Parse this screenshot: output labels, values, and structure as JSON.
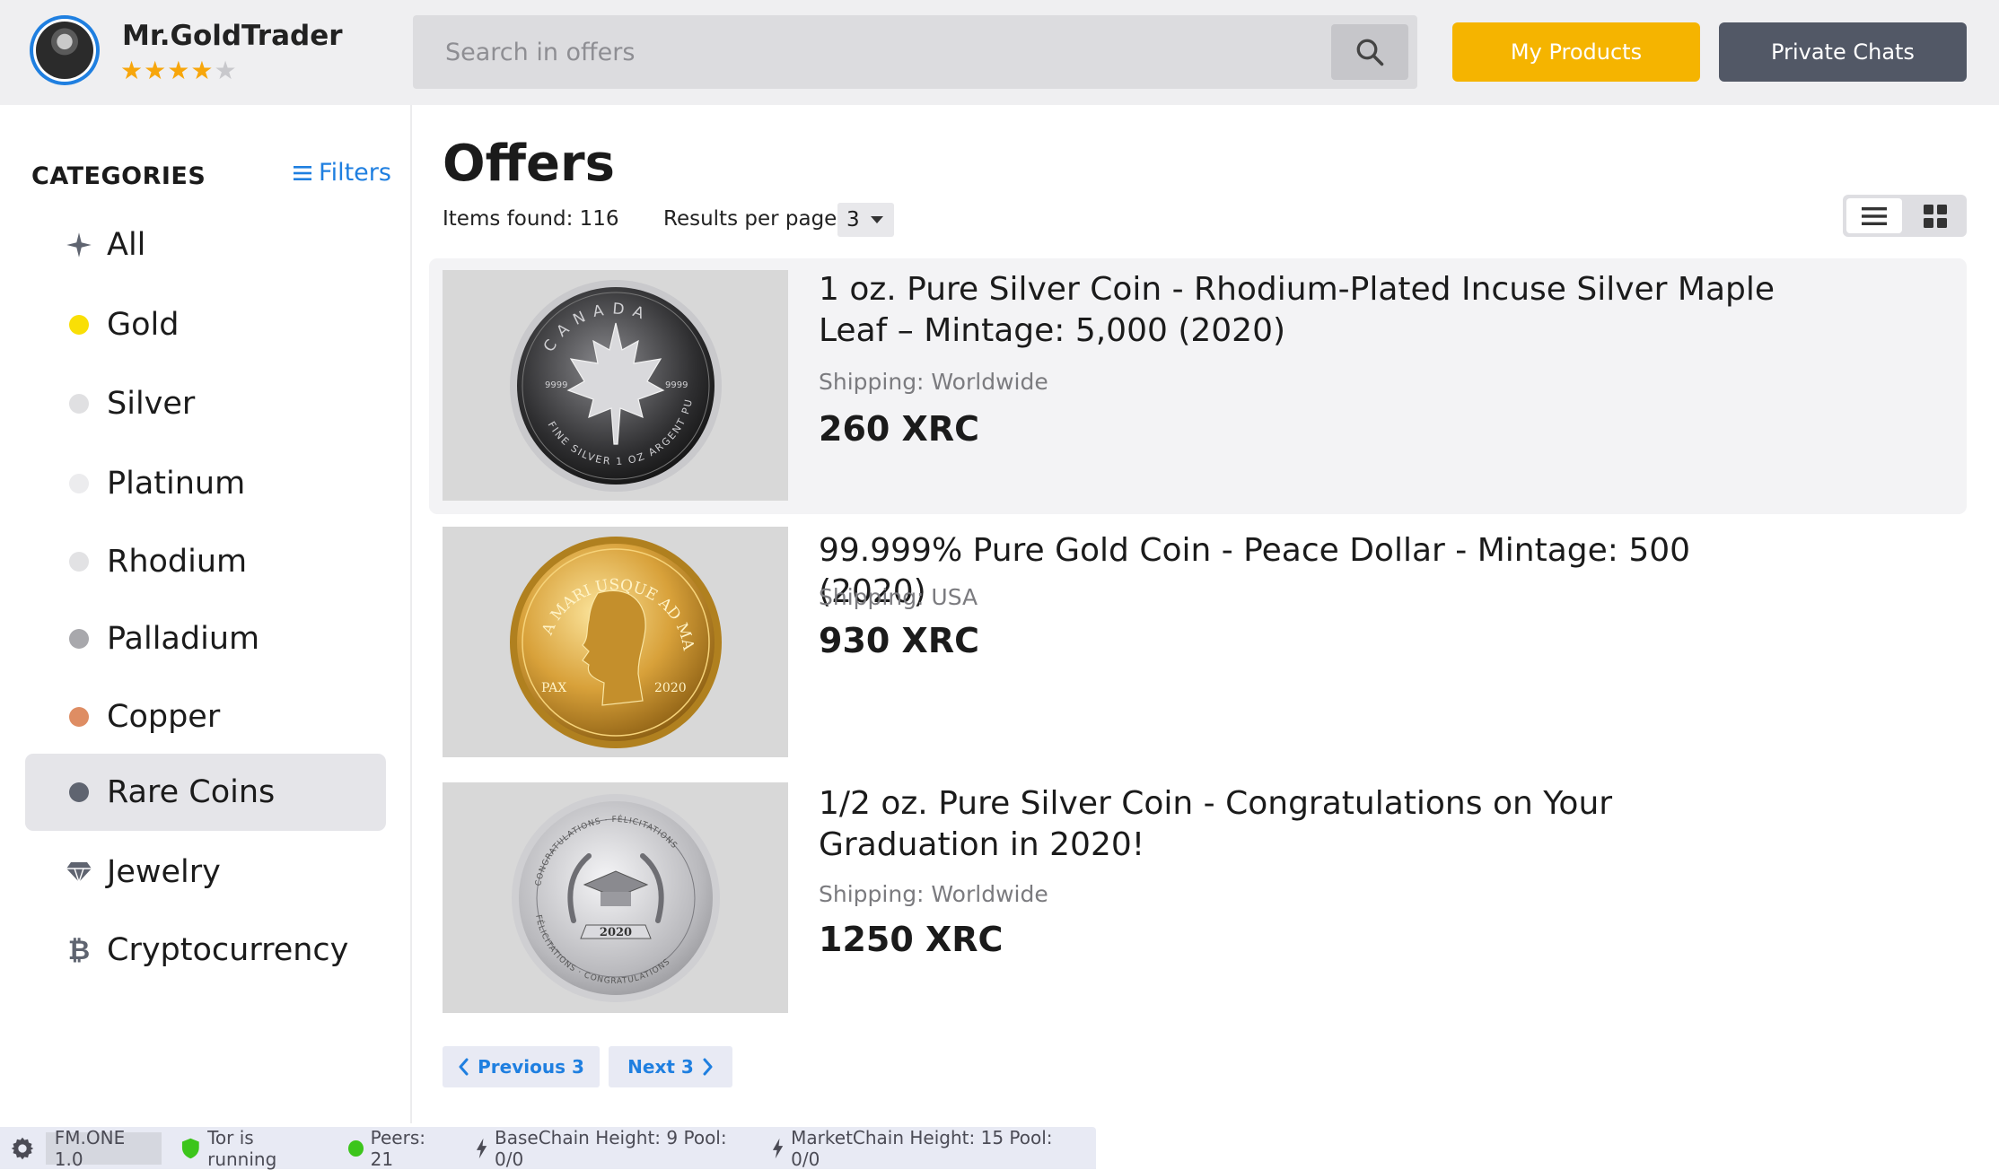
{
  "header": {
    "username": "Mr.GoldTrader",
    "rating": {
      "filled": 4,
      "total": 5
    },
    "search_placeholder": "Search in offers",
    "my_products_label": "My Products",
    "private_chats_label": "Private Chats"
  },
  "sidebar": {
    "title": "CATEGORIES",
    "filters_label": "Filters",
    "items": [
      {
        "label": "All",
        "icon": "sparkle-icon",
        "active": false
      },
      {
        "label": "Gold",
        "icon": "dot",
        "color": "#f9df06",
        "active": false
      },
      {
        "label": "Silver",
        "icon": "dot",
        "color": "#e0e0e2",
        "active": false
      },
      {
        "label": "Platinum",
        "icon": "dot",
        "color": "#ececee",
        "active": false
      },
      {
        "label": "Rhodium",
        "icon": "dot",
        "color": "#e2e2e4",
        "active": false
      },
      {
        "label": "Palladium",
        "icon": "dot",
        "color": "#a8a8ac",
        "active": false
      },
      {
        "label": "Copper",
        "icon": "dot",
        "color": "#de8d63",
        "active": false
      },
      {
        "label": "Rare Coins",
        "icon": "dot",
        "color": "#5f6470",
        "active": true
      },
      {
        "label": "Jewelry",
        "icon": "diamond-icon",
        "active": false
      },
      {
        "label": "Cryptocurrency",
        "icon": "bitcoin-icon",
        "active": false
      }
    ]
  },
  "main": {
    "title": "Offers",
    "items_found": "Items found: 116",
    "results_per_page_label": "Results per page",
    "results_per_page_value": "3",
    "view_mode": "list",
    "offers": [
      {
        "title": "1 oz. Pure Silver Coin - Rhodium-Plated Incuse Silver Maple Leaf – Mintage: 5,000 (2020)",
        "shipping": "Shipping: Worldwide",
        "price": "260 XRC",
        "coin": {
          "top_text": "CANADA",
          "left_mark": "9999",
          "right_mark": "9999",
          "bottom_text": "FINE SILVER 1 OZ ARGENT PUR"
        }
      },
      {
        "title": "99.999% Pure Gold Coin - Peace Dollar - Mintage: 500 (2020)",
        "shipping": "Shipping: USA",
        "price": "930 XRC",
        "coin": {
          "top_text": "A MARI USQUE AD MARE",
          "left_mark": "PAX",
          "right_mark": "2020"
        }
      },
      {
        "title": "1/2 oz. Pure Silver Coin - Congratulations on Your Graduation in 2020!",
        "shipping": "Shipping: Worldwide",
        "price": "1250 XRC",
        "coin": {
          "top_text": "CONGRATULATIONS · FÉLICITATIONS",
          "bottom_text": "FÉLICITATIONS · CONGRATULATIONS",
          "year": "2020"
        }
      }
    ],
    "pagination": {
      "previous_label": "Previous 3",
      "next_label": "Next 3"
    }
  },
  "statusbar": {
    "version": "FM.ONE 1.0",
    "tor_status": "Tor is running",
    "peers": "Peers: 21",
    "basechain": "BaseChain Height: 9 Pool: 0/0",
    "marketchain": "MarketChain Height: 15 Pool: 0/0"
  }
}
